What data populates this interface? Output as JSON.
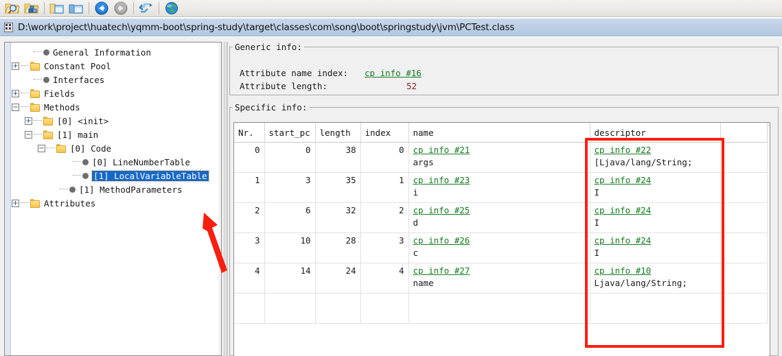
{
  "toolbar": {
    "buttons": [
      {
        "name": "open-class-file-icon",
        "title": "Open class file"
      },
      {
        "name": "open-classpath-icon",
        "title": "Browse class path"
      },
      {
        "name": "new-window-icon",
        "title": "New window"
      },
      {
        "name": "duplicate-window-icon",
        "title": "Duplicate window"
      },
      {
        "name": "back-icon",
        "title": "Backward"
      },
      {
        "name": "forward-icon",
        "title": "Forward"
      },
      {
        "name": "reload-icon",
        "title": "Reload"
      },
      {
        "name": "browse-web-icon",
        "title": "Browse on web"
      }
    ]
  },
  "pathbar": {
    "icon": "class-file-icon",
    "path": "D:\\work\\project\\huatech\\yqmm-boot\\spring-study\\target\\classes\\com\\song\\boot\\springstudy\\jvm\\PCTest.class"
  },
  "tree": {
    "nodes": [
      {
        "label": "General Information",
        "icon": "bullet",
        "depth": 1,
        "expander": "none",
        "selected": false
      },
      {
        "label": "Constant Pool",
        "icon": "folder",
        "depth": 0,
        "expander": "plus",
        "selected": false
      },
      {
        "label": "Interfaces",
        "icon": "bullet",
        "depth": 1,
        "expander": "none",
        "selected": false
      },
      {
        "label": "Fields",
        "icon": "folder",
        "depth": 0,
        "expander": "plus",
        "selected": false
      },
      {
        "label": "Methods",
        "icon": "folder",
        "depth": 0,
        "expander": "minus",
        "selected": false
      },
      {
        "label": "[0] <init>",
        "icon": "folder",
        "depth": 1,
        "expander": "plus",
        "selected": false
      },
      {
        "label": "[1] main",
        "icon": "folder",
        "depth": 1,
        "expander": "minus",
        "selected": false
      },
      {
        "label": "[0] Code",
        "icon": "folder",
        "depth": 2,
        "expander": "minus",
        "selected": false
      },
      {
        "label": "[0] LineNumberTable",
        "icon": "bullet",
        "depth": 4,
        "expander": "none",
        "selected": false
      },
      {
        "label": "[1] LocalVariableTable",
        "icon": "bullet",
        "depth": 4,
        "expander": "none",
        "selected": true
      },
      {
        "label": "[1] MethodParameters",
        "icon": "bullet",
        "depth": 3,
        "expander": "none",
        "selected": false
      },
      {
        "label": "Attributes",
        "icon": "folder",
        "depth": 0,
        "expander": "plus",
        "selected": false
      }
    ]
  },
  "generic_info": {
    "legend": "Generic info:",
    "rows": [
      {
        "label": "Attribute name index:",
        "value": "cp info #16",
        "kind": "link"
      },
      {
        "label": "Attribute length:",
        "value": "52",
        "kind": "number"
      }
    ]
  },
  "specific_info": {
    "legend": "Specific info:",
    "columns": [
      "Nr.",
      "start_pc",
      "length",
      "index",
      "name",
      "descriptor"
    ],
    "rows": [
      {
        "nr": "0",
        "start_pc": "0",
        "length": "38",
        "index": "0",
        "name_link": "cp info #21",
        "name_value": "args",
        "descriptor_link": "cp info #22",
        "descriptor_value": "[Ljava/lang/String;"
      },
      {
        "nr": "1",
        "start_pc": "3",
        "length": "35",
        "index": "1",
        "name_link": "cp info #23",
        "name_value": "i",
        "descriptor_link": "cp info #24",
        "descriptor_value": "I"
      },
      {
        "nr": "2",
        "start_pc": "6",
        "length": "32",
        "index": "2",
        "name_link": "cp info #25",
        "name_value": "d",
        "descriptor_link": "cp info #24",
        "descriptor_value": "I"
      },
      {
        "nr": "3",
        "start_pc": "10",
        "length": "28",
        "index": "3",
        "name_link": "cp info #26",
        "name_value": "c",
        "descriptor_link": "cp info #24",
        "descriptor_value": "I"
      },
      {
        "nr": "4",
        "start_pc": "14",
        "length": "24",
        "index": "4",
        "name_link": "cp info #27",
        "name_value": "name",
        "descriptor_link": "cp info #10",
        "descriptor_value": "Ljava/lang/String;"
      }
    ]
  },
  "annotations": {
    "highlight_color": "#fb1e11",
    "rect_target": "descriptor-column",
    "arrow_target": "tree-node-local-variable-table"
  },
  "colors": {
    "link_green": "#127a1e",
    "number_red": "#8c2020",
    "selection_blue": "#1769c9",
    "annotation_red": "#fb1e11"
  }
}
